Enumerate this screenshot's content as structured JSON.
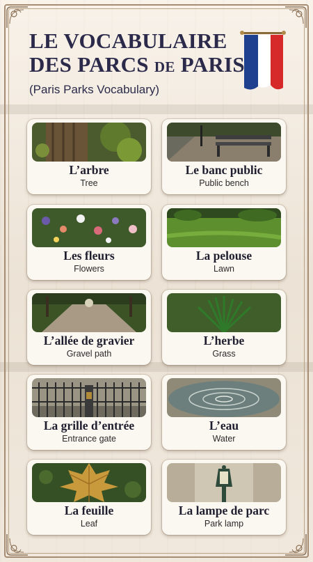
{
  "header": {
    "title_line1": "LE VOCABULAIRE",
    "title_line2_a": "DES PARCS",
    "title_line2_de": "DE",
    "title_line2_b": "PARIS",
    "subtitle": "(Paris Parks Vocabulary)"
  },
  "flag_colors": [
    "#1f3f8f",
    "#ffffff",
    "#d62a2a"
  ],
  "cards": [
    {
      "french": "L’arbre",
      "english": "Tree",
      "icon": "tree-image"
    },
    {
      "french": "Le banc public",
      "english": "Public bench",
      "icon": "bench-image"
    },
    {
      "french": "Les fleurs",
      "english": "Flowers",
      "icon": "flowers-image"
    },
    {
      "french": "La pelouse",
      "english": "Lawn",
      "icon": "lawn-image"
    },
    {
      "french": "L’allée de gravier",
      "english": "Gravel path",
      "icon": "gravel-path-image"
    },
    {
      "french": "L’herbe",
      "english": "Grass",
      "icon": "grass-image"
    },
    {
      "french": "La grille d’entrée",
      "english": "Entrance gate",
      "icon": "gate-image"
    },
    {
      "french": "L’eau",
      "english": "Water",
      "icon": "water-image"
    },
    {
      "french": "La feuille",
      "english": "Leaf",
      "icon": "leaf-image"
    },
    {
      "french": "La lampe de parc",
      "english": "Park lamp",
      "icon": "lamp-image"
    }
  ]
}
